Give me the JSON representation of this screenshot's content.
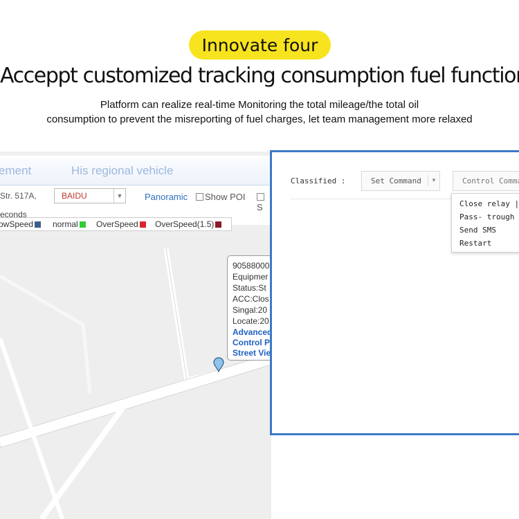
{
  "badge": "Innovate four",
  "headline": "Acceppt customized tracking consumption fuel function",
  "subtitle": {
    "line1": "Platform can realize real-time Monitoring  the total mileage/the total oil",
    "line2": "consumption to prevent the misreporting of fuel charges, let team management more relaxed"
  },
  "map_panel": {
    "tabs": [
      "ement",
      "His regional vehicle"
    ],
    "address": "Str. 517A,",
    "map_select": "BAIDU",
    "panoramic": "Panoramic",
    "show_poi": "Show POI",
    "s_checkbox": "S",
    "seconds": "econds",
    "legend": [
      {
        "label": "owSpeed",
        "color": "#3a5f8a"
      },
      {
        "label": "normal",
        "color": "#33cc33"
      },
      {
        "label": "OverSpeed",
        "color": "#d9262b"
      },
      {
        "label": "OverSpeed(1.5)",
        "color": "#8b1a2b"
      }
    ],
    "popup": {
      "id": "90588000",
      "equipment": "Equipmer",
      "status": "Status:St",
      "acc": "ACC:Clos",
      "signal": "Singal:20",
      "locate": "Locate:20",
      "advanced": "Advanced",
      "control": "Control P",
      "street": "Street Vie"
    }
  },
  "command_dialog": {
    "classified_label": "Classified :",
    "set_command": "Set Command",
    "control_command": "Control Comma",
    "menu": [
      "Close relay | C",
      "Pass- trough",
      "Send SMS",
      "Restart"
    ]
  },
  "colors": {
    "accent_badge": "#f7e41e",
    "dialog_border": "#3b79c6",
    "link": "#1f5fbf"
  }
}
